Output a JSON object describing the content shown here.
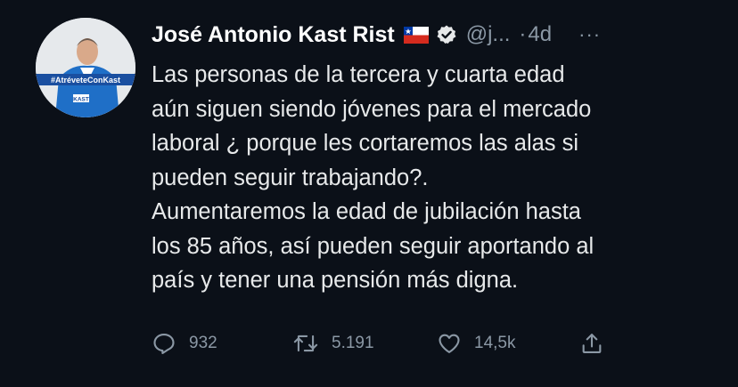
{
  "tweet": {
    "author_name": "José Antonio Kast Rist",
    "handle": "@j...",
    "separator": "·",
    "time": "4d",
    "more": "···",
    "avatar_banner": "#AtréveteConKast",
    "avatar_logo": "KAST",
    "body_lines": [
      "Las personas de la tercera y cuarta edad",
      "aún siguen siendo jóvenes para el mercado",
      "laboral ¿ porque les cortaremos las alas si",
      "pueden seguir trabajando?.",
      "Aumentaremos la edad de jubilación hasta",
      "los 85 años, así pueden seguir aportando al",
      "país y tener una pensión más digna."
    ],
    "actions": {
      "replies": "932",
      "retweets": "5.191",
      "likes": "14,5k"
    }
  },
  "colors": {
    "background": "#0b1018",
    "text": "#e7e9ea",
    "muted": "#8b98a5",
    "jacket": "#1f6fc7"
  },
  "icons": [
    "chile-flag-icon",
    "verified-badge-icon",
    "more-icon",
    "reply-icon",
    "retweet-icon",
    "like-icon",
    "share-icon"
  ]
}
